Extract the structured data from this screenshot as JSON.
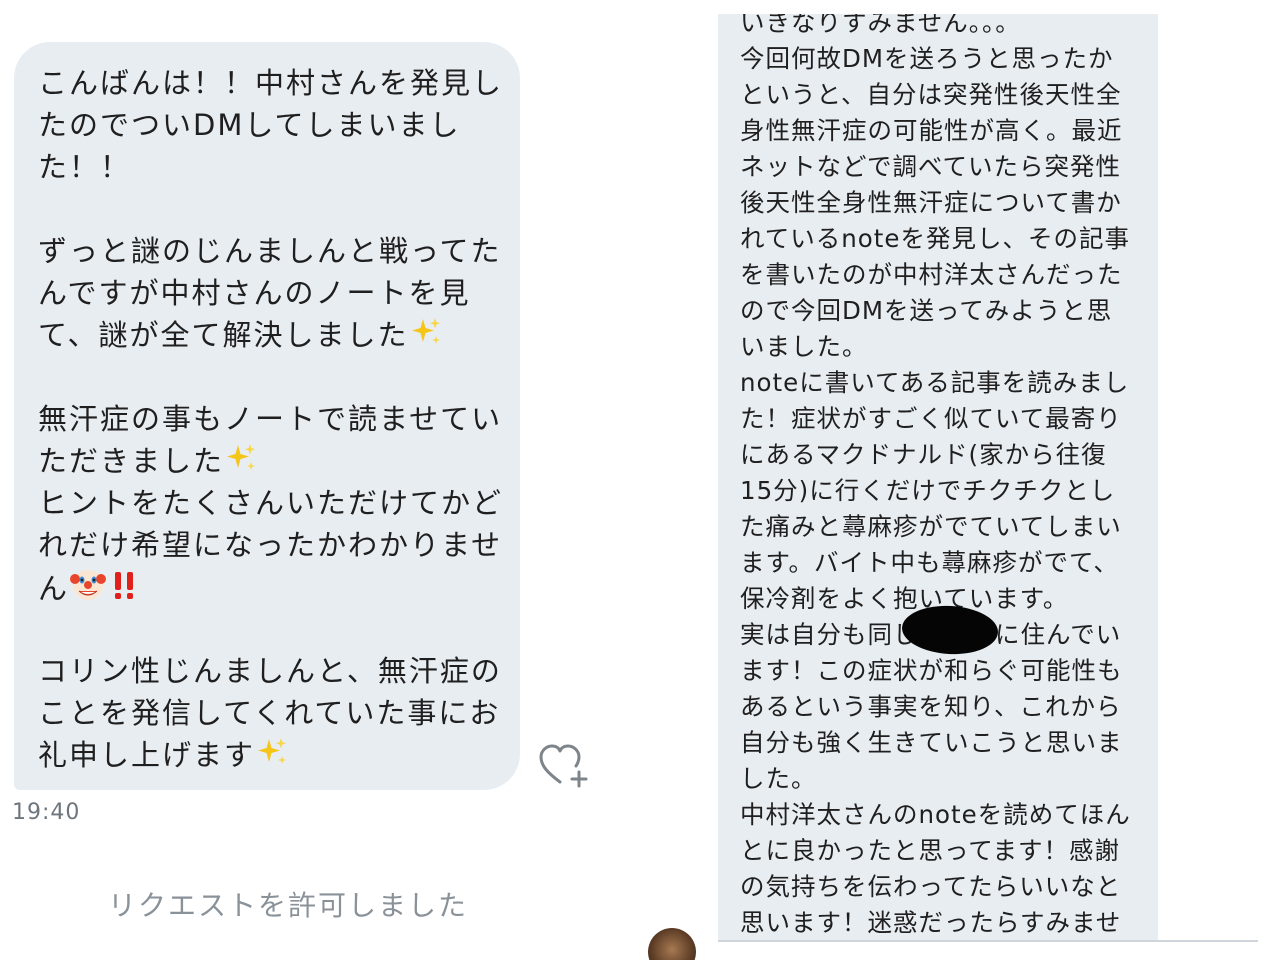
{
  "left": {
    "lines": [
      "こんばんは！！中村さんを発見し",
      "たのでついDMしてしまいまし",
      "た！！",
      "",
      "ずっと謎のじんましんと戦ってた",
      "んですが中村さんのノートを見",
      "て、謎が全て解決しました",
      "",
      "無汗症の事もノートで読ませてい",
      "ただきました",
      "ヒントをたくさんいただけてかど",
      "れだけ希望になったかわかりませ",
      "ん",
      "",
      "コリン性じんましんと、無汗症の",
      "ことを発信してくれていた事にお",
      "礼申し上げます"
    ],
    "time": "19:40",
    "request_status": "リクエストを許可しました",
    "icons": [
      "sparkles-icon",
      "clown-face-icon",
      "double-exclamation-icon",
      "heart-plus-icon"
    ]
  },
  "right": {
    "lines": [
      "いきなりすみません。。。",
      "今回何故DMを送ろうと思ったか",
      "というと、自分は突発性後天性全",
      "身性無汗症の可能性が高く。最近",
      "ネットなどで調べていたら突発性",
      "後天性全身性無汗症について書か",
      "れているnoteを発見し、その記事",
      "を書いたのが中村洋太さんだった",
      "ので今回DMを送ってみようと思",
      "いました。",
      "noteに書いてある記事を読みまし",
      "た！症状がすごく似ていて最寄り",
      "にあるマクドナルド(家から往復",
      "15分)に行くだけでチクチクとし",
      "た痛みと蕁麻疹がでていてしまい",
      "ます。バイト中も蕁麻疹がでて、",
      "保冷剤をよく抱いています。",
      "実は自分も同じ　　　に住んでい",
      "ます！この症状が和らぐ可能性も",
      "あるという事実を知り、これから",
      "自分も強く生きていこうと思いま",
      "した。",
      "中村洋太さんのnoteを読めてほん",
      "とに良かったと思ってます！感謝",
      "の気持ちを伝わってたらいいなと",
      "思います！迷惑だったらすみませ"
    ]
  },
  "colors": {
    "bubble": "#e8edf2",
    "text": "#1f1f1f",
    "muted": "#8a9299",
    "redaction": "#050505"
  }
}
